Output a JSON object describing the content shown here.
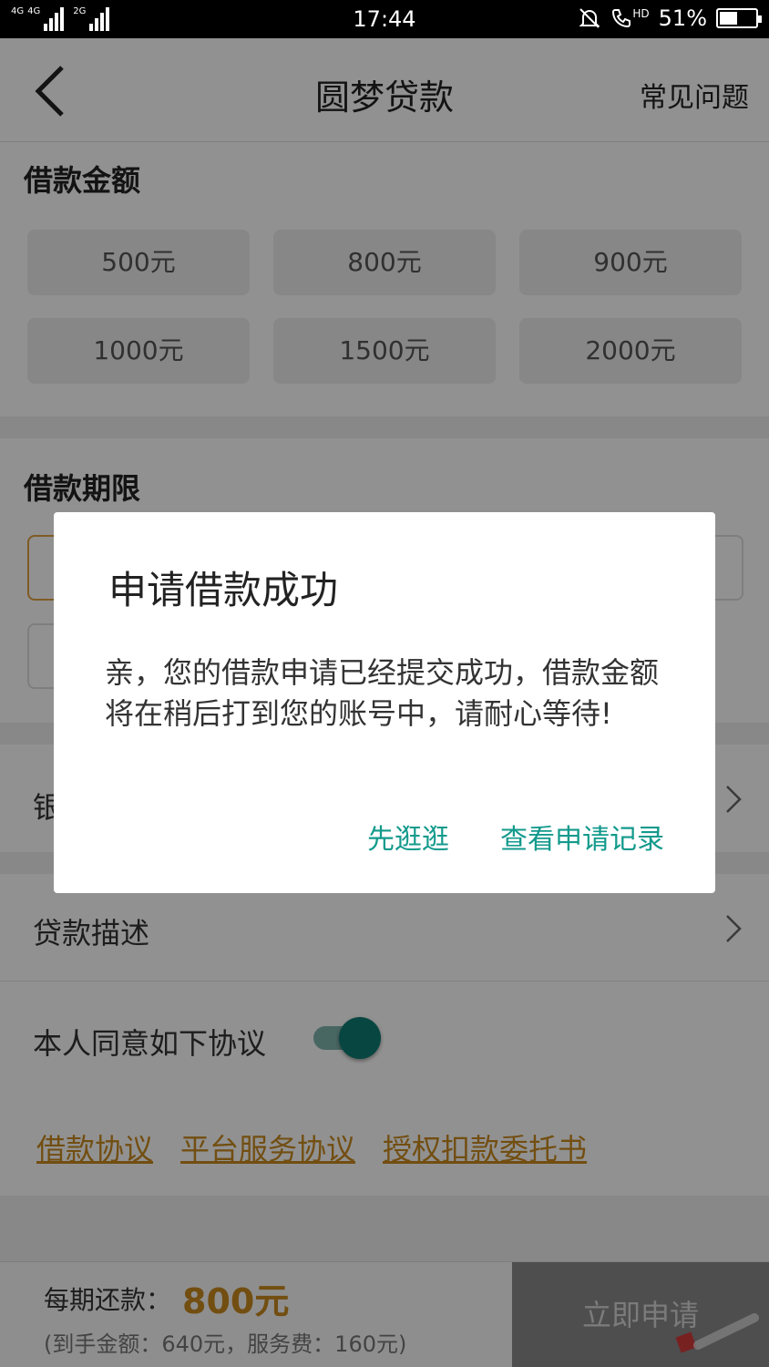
{
  "status_bar": {
    "network1": "4G",
    "network2": "4G",
    "network3": "2G",
    "time": "17:44",
    "hd": "HD",
    "battery": "51%",
    "battery_level": 0.51
  },
  "nav": {
    "title": "圆梦贷款",
    "faq": "常见问题"
  },
  "amount_section": {
    "title": "借款金额",
    "options": [
      "500元",
      "800元",
      "900元",
      "1000元",
      "1500元",
      "2000元"
    ]
  },
  "term_section": {
    "title": "借款期限"
  },
  "rows": {
    "bank_partial": "银",
    "description": "贷款描述",
    "agree": "本人同意如下协议"
  },
  "toggle_on": true,
  "links": [
    "借款协议",
    "平台服务协议",
    "授权扣款委托书"
  ],
  "bottom": {
    "per_label": "每期还款：",
    "per_value": "800元",
    "detail": "(到手金额：640元，服务费：160元)",
    "apply": "立即申请"
  },
  "dialog": {
    "title": "申请借款成功",
    "message": "亲，您的借款申请已经提交成功，借款金额将在稍后打到您的账号中，请耐心等待!",
    "btn_browse": "先逛逛",
    "btn_records": "查看申请记录"
  },
  "colors": {
    "accent": "#c98a1e",
    "teal": "#139a8c"
  }
}
